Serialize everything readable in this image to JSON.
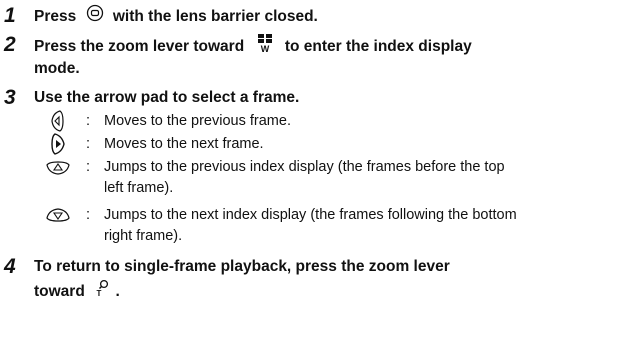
{
  "steps": [
    {
      "number": "1",
      "parts": [
        "Press",
        "with the lens barrier closed."
      ],
      "icons": [
        "playback-button-icon"
      ]
    },
    {
      "number": "2",
      "parts": [
        "Press the zoom lever toward",
        "to enter the index display",
        "mode."
      ],
      "icons": [
        "zoom-w-index-icon"
      ]
    },
    {
      "number": "3",
      "parts": [
        "Use the arrow pad to select a frame."
      ],
      "items": [
        {
          "icon": "arrow-left-icon",
          "colon": ":",
          "lines": [
            "Moves to the previous frame."
          ]
        },
        {
          "icon": "arrow-right-icon",
          "colon": ":",
          "lines": [
            "Moves to the next frame."
          ]
        },
        {
          "icon": "arrow-up-icon",
          "colon": ":",
          "lines": [
            "Jumps to the previous index display (the frames before the top",
            "left frame)."
          ]
        },
        {
          "icon": "arrow-down-icon",
          "colon": ":",
          "lines": [
            "Jumps to the next index display (the frames following the bottom",
            "right frame)."
          ]
        }
      ]
    },
    {
      "number": "4",
      "parts": [
        "To return to single-frame playback, press the zoom lever",
        "toward",
        "."
      ],
      "icons": [
        "zoom-t-icon"
      ]
    }
  ]
}
